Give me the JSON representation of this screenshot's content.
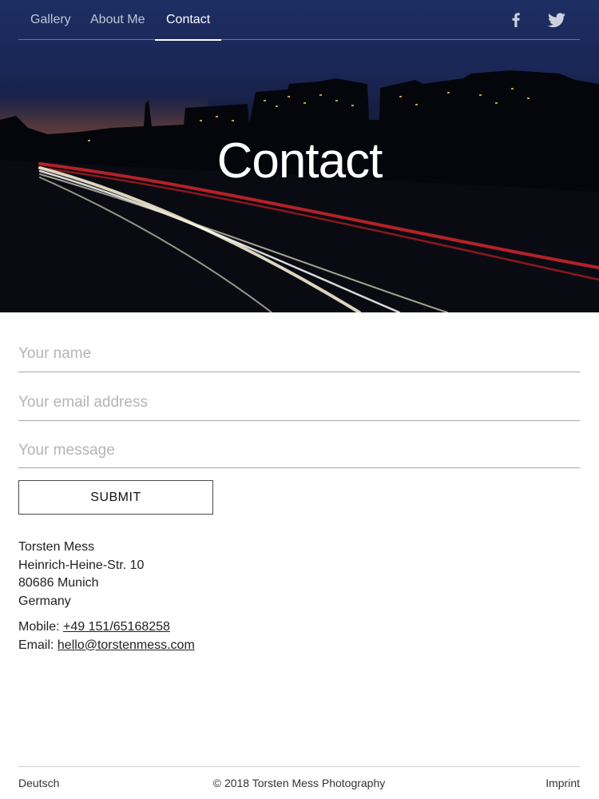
{
  "nav": {
    "items": [
      {
        "label": "Gallery"
      },
      {
        "label": "About Me"
      },
      {
        "label": "Contact"
      }
    ],
    "active": "Contact",
    "social": [
      "facebook-icon",
      "twitter-icon"
    ]
  },
  "hero": {
    "title": "Contact"
  },
  "form": {
    "name_placeholder": "Your name",
    "email_placeholder": "Your email address",
    "message_placeholder": "Your message",
    "submit_label": "SUBMIT"
  },
  "address": {
    "name": "Torsten Mess",
    "street": "Heinrich-Heine-Str. 10",
    "city": "80686 Munich",
    "country": "Germany"
  },
  "contact": {
    "mobile_label": "Mobile:",
    "mobile": "+49 151/65168258",
    "email_label": "Email:",
    "email": "hello@torstenmess.com"
  },
  "footer": {
    "language": "Deutsch",
    "copyright": "© 2018 Torsten Mess Photography",
    "imprint": "Imprint"
  }
}
